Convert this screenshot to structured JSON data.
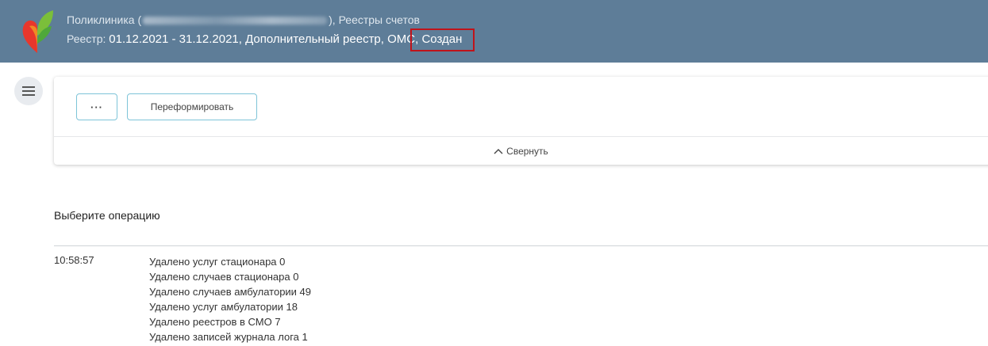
{
  "header": {
    "clinic_prefix": "Поликлиника (",
    "clinic_suffix": "), Реестры счетов",
    "registry_label": "Реестр: ",
    "registry_value": "01.12.2021 - 31.12.2021, Дополнительный реестр, ОМС",
    "status": ", Создан",
    "background_color": "#5e7d98",
    "highlight_color": "#c0131a"
  },
  "toolbar": {
    "more_label": "···",
    "reform_label": "Переформировать",
    "collapse_label": "Свернуть",
    "collapse_icon": "chevron-up-icon"
  },
  "operations": {
    "title": "Выберите операцию",
    "log": {
      "time": "10:58:57",
      "lines": [
        "Удалено услуг стационара 0",
        "Удалено случаев стационара 0",
        "Удалено случаев амбулатории 49",
        "Удалено услуг амбулатории 18",
        "Удалено реестров в СМО 7",
        "Удалено записей журнала лога 1"
      ]
    }
  },
  "icons": {
    "menu": "hamburger-menu-icon",
    "logo": "heart-leaf-logo"
  }
}
